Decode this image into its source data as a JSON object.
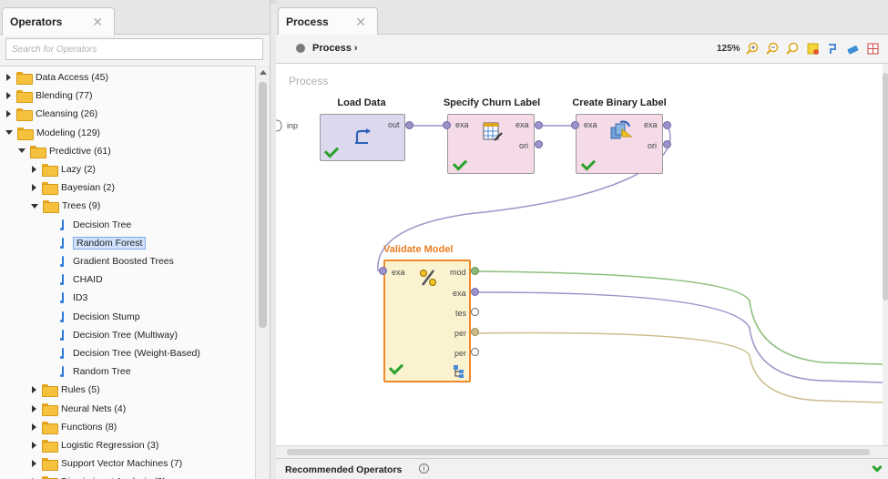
{
  "operators_panel": {
    "tab_label": "Operators",
    "search_placeholder": "Search for Operators",
    "tree": [
      {
        "label": "Data Access (45)",
        "kind": "folder",
        "state": "closed",
        "level": 0
      },
      {
        "label": "Blending (77)",
        "kind": "folder",
        "state": "closed",
        "level": 0
      },
      {
        "label": "Cleansing (26)",
        "kind": "folder",
        "state": "closed",
        "level": 0
      },
      {
        "label": "Modeling (129)",
        "kind": "folder",
        "state": "open",
        "level": 0
      },
      {
        "label": "Predictive (61)",
        "kind": "folder",
        "state": "open",
        "level": 1
      },
      {
        "label": "Lazy (2)",
        "kind": "folder",
        "state": "closed",
        "level": 2
      },
      {
        "label": "Bayesian (2)",
        "kind": "folder",
        "state": "closed",
        "level": 2
      },
      {
        "label": "Trees (9)",
        "kind": "folder",
        "state": "open",
        "level": 2
      },
      {
        "label": "Decision Tree",
        "kind": "leaf",
        "level": 3
      },
      {
        "label": "Random Forest",
        "kind": "leaf",
        "level": 3,
        "selected": true
      },
      {
        "label": "Gradient Boosted Trees",
        "kind": "leaf",
        "level": 3
      },
      {
        "label": "CHAID",
        "kind": "leaf",
        "level": 3
      },
      {
        "label": "ID3",
        "kind": "leaf",
        "level": 3
      },
      {
        "label": "Decision Stump",
        "kind": "leaf",
        "level": 3
      },
      {
        "label": "Decision Tree (Multiway)",
        "kind": "leaf",
        "level": 3
      },
      {
        "label": "Decision Tree (Weight-Based)",
        "kind": "leaf",
        "level": 3
      },
      {
        "label": "Random Tree",
        "kind": "leaf",
        "level": 3
      },
      {
        "label": "Rules (5)",
        "kind": "folder",
        "state": "closed",
        "level": 2
      },
      {
        "label": "Neural Nets (4)",
        "kind": "folder",
        "state": "closed",
        "level": 2
      },
      {
        "label": "Functions (8)",
        "kind": "folder",
        "state": "closed",
        "level": 2
      },
      {
        "label": "Logistic Regression (3)",
        "kind": "folder",
        "state": "closed",
        "level": 2
      },
      {
        "label": "Support Vector Machines (7)",
        "kind": "folder",
        "state": "closed",
        "level": 2
      },
      {
        "label": "Discriminant Analysis (3)",
        "kind": "folder",
        "state": "closed",
        "level": 2
      }
    ]
  },
  "process_panel": {
    "tab_label": "Process",
    "breadcrumb": "Process ›",
    "zoom": "125%",
    "canvas_label": "Process",
    "input_port": "inp",
    "operators": {
      "load_data": {
        "title": "Load Data",
        "ports_out": [
          "out"
        ]
      },
      "specify_churn": {
        "title": "Specify Churn Label",
        "ports_in": [
          "exa"
        ],
        "ports_out": [
          "exa",
          "ori"
        ]
      },
      "create_binary": {
        "title": "Create Binary Label",
        "ports_in": [
          "exa"
        ],
        "ports_out": [
          "exa",
          "ori"
        ]
      },
      "validate_model": {
        "title": "Validate Model",
        "ports_in": [
          "exa"
        ],
        "ports_out": [
          "mod",
          "exa",
          "tes",
          "per",
          "per"
        ]
      }
    },
    "recommended_label": "Recommended Operators"
  },
  "colors": {
    "load_data_bg": "#dcd9ee",
    "pink_op_bg": "#f4dbe7",
    "validate_bg": "#fbf3d0",
    "validate_border": "#ee8a2d",
    "validate_title": "#ee7d1f",
    "selection": "#cfe1fb",
    "status_green": "#2aa22a"
  }
}
